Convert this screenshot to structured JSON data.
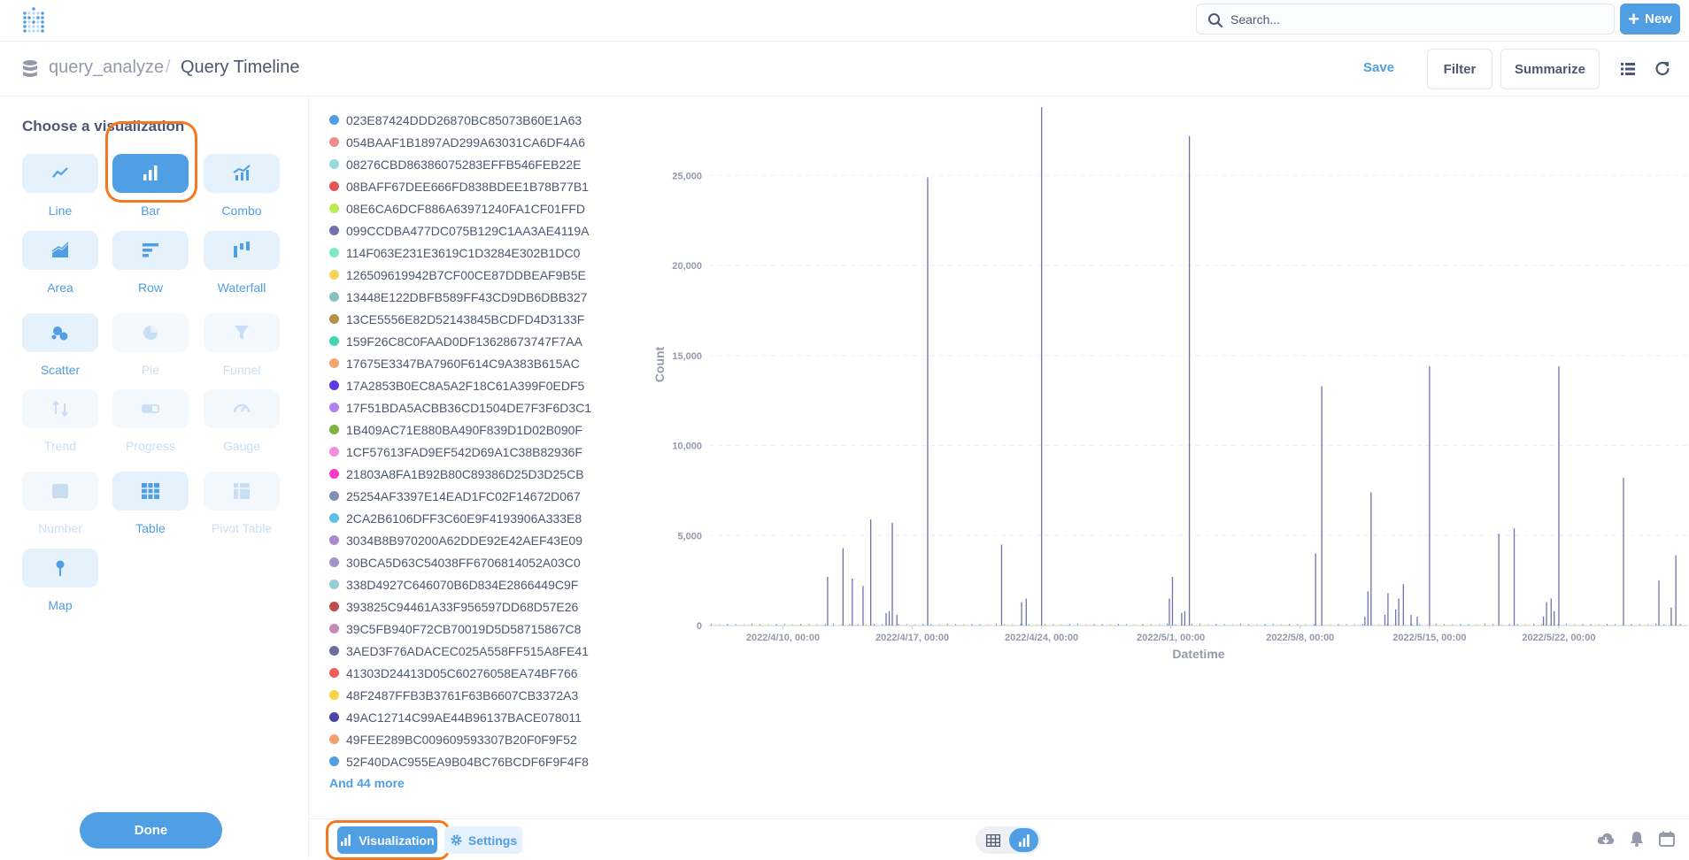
{
  "topnav": {
    "search_placeholder": "Search...",
    "new_label": "New"
  },
  "header": {
    "database": "query_analyze",
    "separator": "/",
    "title": "Query Timeline",
    "save_label": "Save",
    "filter_label": "Filter",
    "summarize_label": "Summarize"
  },
  "sidebar": {
    "title": "Choose a visualization",
    "options": [
      {
        "label": "Line",
        "icon": "line-chart-icon",
        "state": "enabled"
      },
      {
        "label": "Bar",
        "icon": "bar-chart-icon",
        "state": "active"
      },
      {
        "label": "Combo",
        "icon": "combo-chart-icon",
        "state": "enabled"
      },
      {
        "label": "Area",
        "icon": "area-chart-icon",
        "state": "enabled"
      },
      {
        "label": "Row",
        "icon": "row-chart-icon",
        "state": "enabled"
      },
      {
        "label": "Waterfall",
        "icon": "waterfall-chart-icon",
        "state": "enabled"
      },
      {
        "label": "Scatter",
        "icon": "scatter-chart-icon",
        "state": "enabled"
      },
      {
        "label": "Pie",
        "icon": "pie-chart-icon",
        "state": "disabled"
      },
      {
        "label": "Funnel",
        "icon": "funnel-icon",
        "state": "disabled"
      },
      {
        "label": "Trend",
        "icon": "trend-icon",
        "state": "disabled"
      },
      {
        "label": "Progress",
        "icon": "progress-icon",
        "state": "disabled"
      },
      {
        "label": "Gauge",
        "icon": "gauge-icon",
        "state": "disabled"
      },
      {
        "label": "Number",
        "icon": "number-icon",
        "state": "disabled"
      },
      {
        "label": "Table",
        "icon": "table-icon",
        "state": "enabled"
      },
      {
        "label": "Pivot Table",
        "icon": "pivot-table-icon",
        "state": "disabled"
      },
      {
        "label": "Map",
        "icon": "map-pin-icon",
        "state": "enabled"
      }
    ],
    "done_label": "Done"
  },
  "legend": {
    "items": [
      {
        "label": "023E87424DDD26870BC85073B60E1A63",
        "color": "#509ee3"
      },
      {
        "label": "054BAAF1B1897AD299A63031CA6DF4A6",
        "color": "#ef8c8c"
      },
      {
        "label": "08276CBD86386075283EFFB546FEB22E",
        "color": "#98d9d9"
      },
      {
        "label": "08BAFF67DEE666FD838BDEE1B78B77B1",
        "color": "#e75454"
      },
      {
        "label": "08E6CA6DCF886A63971240FA1CF01FFD",
        "color": "#b8ec50"
      },
      {
        "label": "099CCDBA477DC075B129C1AA3AE4119A",
        "color": "#7172ad"
      },
      {
        "label": "114F063E231E3619C1D3284E302B1DC0",
        "color": "#7eeac3"
      },
      {
        "label": "126509619942B7CF00CE87DDBEAF9B5E",
        "color": "#f9d45c"
      },
      {
        "label": "13448E122DBFB589FF43CD9DB6DBB327",
        "color": "#88bfbf"
      },
      {
        "label": "13CE5556E82D52143845BCDFD4D3133F",
        "color": "#b39347"
      },
      {
        "label": "159F26C8C0FAAD0DF13628673747F7AA",
        "color": "#3ed7b3"
      },
      {
        "label": "17675E3347BA7960F614C9A383B615AC",
        "color": "#f2a86f"
      },
      {
        "label": "17A2853B0EC8A5A2F18C61A399F0EDF5",
        "color": "#5b3ae1"
      },
      {
        "label": "17F51BDA5ACBB36CD1504DE7F3F6D3C1",
        "color": "#b47ff0"
      },
      {
        "label": "1B409AC71E880BA490F839D1D02B090F",
        "color": "#7cb342"
      },
      {
        "label": "1CF57613FAD9EF542D69A1C38B82936F",
        "color": "#f08ddf"
      },
      {
        "label": "21803A8FA1B92B80C89386D25D3D25CB",
        "color": "#f73cc8"
      },
      {
        "label": "25254AF3397E14EAD1FC02F14672D067",
        "color": "#8290b5"
      },
      {
        "label": "2CA2B6106DFF3C60E9F4193906A333E8",
        "color": "#5ac0e8"
      },
      {
        "label": "3034B8B970200A62DDE92E42AEF43E09",
        "color": "#a88bc8"
      },
      {
        "label": "30BCA5D63C54038FF6706814052A03C0",
        "color": "#a393c4"
      },
      {
        "label": "338D4927C646070B6D834E2866449C9F",
        "color": "#96cdd6"
      },
      {
        "label": "393825C94461A33F956597DD68D57E26",
        "color": "#c04b4b"
      },
      {
        "label": "39C5FB940F72CB70019D5D58715867C8",
        "color": "#c58bb8"
      },
      {
        "label": "3AED3F76ADACEC025A558FF515A8FE41",
        "color": "#6b6fa0"
      },
      {
        "label": "41303D24413D05C60276058EA74BF766",
        "color": "#ef5d5d"
      },
      {
        "label": "48F2487FFB3B3761F63B6607CB3372A3",
        "color": "#f9d147"
      },
      {
        "label": "49AC12714C99AE44B96137BACE078011",
        "color": "#4a44a8"
      },
      {
        "label": "49FEE289BC009609593307B20F0F9F52",
        "color": "#f2a06f"
      },
      {
        "label": "52F40DAC955EA9B04BC76BCDF6F9F4F8",
        "color": "#509ee3"
      }
    ],
    "more_label": "And 44 more"
  },
  "chart_data": {
    "type": "bar",
    "xlabel": "Datetime",
    "ylabel": "Count",
    "ylim": [
      0,
      29000
    ],
    "y_ticks": [
      0,
      5000,
      10000,
      15000,
      20000,
      25000
    ],
    "y_tick_labels": [
      "0",
      "5,000",
      "10,000",
      "15,000",
      "20,000",
      "25,000"
    ],
    "x_range": [
      "2022-04-06 00:00",
      "2022-05-29 00:00"
    ],
    "x_ticks": [
      "2022-04-10 00:00",
      "2022-04-17 00:00",
      "2022-04-24 00:00",
      "2022-05-01 00:00",
      "2022-05-08 00:00",
      "2022-05-15 00:00",
      "2022-05-22 00:00"
    ],
    "x_tick_labels": [
      "2022/4/10, 00:00",
      "2022/4/17, 00:00",
      "2022/4/24, 00:00",
      "2022/5/1, 00:00",
      "2022/5/8, 00:00",
      "2022/5/15, 00:00",
      "2022/5/22, 00:00"
    ],
    "grid": true,
    "series": [
      {
        "color": "#7172ad",
        "points": [
          [
            "2022-04-12 10:00",
            2700
          ],
          [
            "2022-04-13 06:00",
            4300
          ],
          [
            "2022-04-13 18:00",
            2600
          ],
          [
            "2022-04-14 08:00",
            2200
          ],
          [
            "2022-04-14 18:00",
            5900
          ],
          [
            "2022-04-15 14:00",
            700
          ],
          [
            "2022-04-15 18:00",
            800
          ],
          [
            "2022-04-15 22:00",
            5700
          ],
          [
            "2022-04-16 04:00",
            600
          ],
          [
            "2022-04-17 20:00",
            24900
          ],
          [
            "2022-04-21 20:00",
            4500
          ],
          [
            "2022-04-22 22:00",
            1300
          ],
          [
            "2022-04-23 04:00",
            1500
          ],
          [
            "2022-04-24 00:00",
            28800
          ],
          [
            "2022-04-30 22:00",
            1500
          ],
          [
            "2022-05-01 02:00",
            2700
          ],
          [
            "2022-05-01 14:00",
            700
          ],
          [
            "2022-05-01 18:00",
            800
          ],
          [
            "2022-05-02 00:00",
            27200
          ],
          [
            "2022-05-08 20:00",
            4000
          ],
          [
            "2022-05-09 04:00",
            13300
          ],
          [
            "2022-05-11 12:00",
            500
          ],
          [
            "2022-05-11 16:00",
            1900
          ],
          [
            "2022-05-11 20:00",
            7400
          ],
          [
            "2022-05-12 14:00",
            600
          ],
          [
            "2022-05-12 18:00",
            1800
          ],
          [
            "2022-05-13 04:00",
            900
          ],
          [
            "2022-05-13 08:00",
            1500
          ],
          [
            "2022-05-13 14:00",
            2300
          ],
          [
            "2022-05-14 00:00",
            600
          ],
          [
            "2022-05-14 08:00",
            500
          ],
          [
            "2022-05-15 00:00",
            14400
          ],
          [
            "2022-05-18 18:00",
            5100
          ],
          [
            "2022-05-19 14:00",
            5400
          ],
          [
            "2022-05-21 04:00",
            500
          ],
          [
            "2022-05-21 08:00",
            1300
          ],
          [
            "2022-05-21 14:00",
            1500
          ],
          [
            "2022-05-21 18:00",
            800
          ],
          [
            "2022-05-22 00:00",
            14400
          ],
          [
            "2022-05-25 12:00",
            8200
          ],
          [
            "2022-05-27 10:00",
            2500
          ],
          [
            "2022-05-28 02:00",
            1000
          ],
          [
            "2022-05-28 08:00",
            3900
          ]
        ]
      }
    ]
  },
  "footer": {
    "visualization_label": "Visualization",
    "settings_label": "Settings"
  }
}
